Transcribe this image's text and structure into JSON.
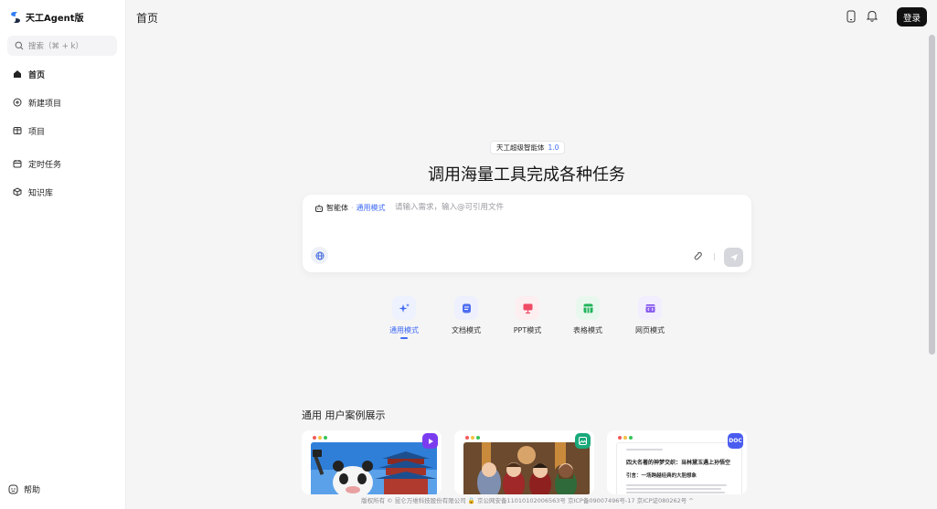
{
  "app": {
    "name": "天工Agent版"
  },
  "sidebar": {
    "search_placeholder": "搜索（⌘ + k）",
    "items": [
      {
        "label": "首页",
        "icon": "home-icon",
        "active": true
      },
      {
        "label": "新建项目",
        "icon": "plus-circle-icon"
      },
      {
        "label": "项目",
        "icon": "project-box-icon"
      },
      {
        "label": "定时任务",
        "icon": "calendar-icon"
      },
      {
        "label": "知识库",
        "icon": "cube-icon"
      }
    ],
    "help_label": "帮助"
  },
  "header": {
    "title": "首页",
    "login_label": "登录"
  },
  "hero": {
    "badge_text": "天工超级智能体",
    "badge_version": "1.0",
    "title": "调用海量工具完成各种任务"
  },
  "input": {
    "agent_label": "智能体",
    "separator": "·",
    "mode_label": "通用模式",
    "placeholder": "请输入需求，输入@可引用文件"
  },
  "modes": [
    {
      "label": "通用模式",
      "icon": "sparkle-icon",
      "active": true,
      "color": "#3f6bf5",
      "bg": "#eef2fe"
    },
    {
      "label": "文档模式",
      "icon": "document-icon",
      "color": "#4f6ef2",
      "bg": "#eef1fd"
    },
    {
      "label": "PPT模式",
      "icon": "presentation-icon",
      "color": "#ef4b64",
      "bg": "#fdeef0"
    },
    {
      "label": "表格模式",
      "icon": "table-icon",
      "color": "#21b35a",
      "bg": "#e9f8ef"
    },
    {
      "label": "网页模式",
      "icon": "webpage-code-icon",
      "color": "#8a5cf0",
      "bg": "#f3eefd"
    }
  ],
  "cases": {
    "title": "通用 用户案例展示",
    "items": [
      {
        "tag": "play",
        "tag_color": "#7b3cf0"
      },
      {
        "tag": "image",
        "tag_color": "#1aa97a"
      },
      {
        "tag": "DOC",
        "tag_color": "#4a5cf0",
        "doc_heading": "四大名著的神梦交织：当林黛玉遇上孙悟空",
        "doc_sub": "引言：一场跨越经典的大胆想象"
      }
    ]
  },
  "footer": {
    "text": "版权所有 © 昆仑万维科技股份有限公司 🔒 京公网安备11010102006563号 京ICP备09007496号-17 京ICP证080262号 ^"
  }
}
